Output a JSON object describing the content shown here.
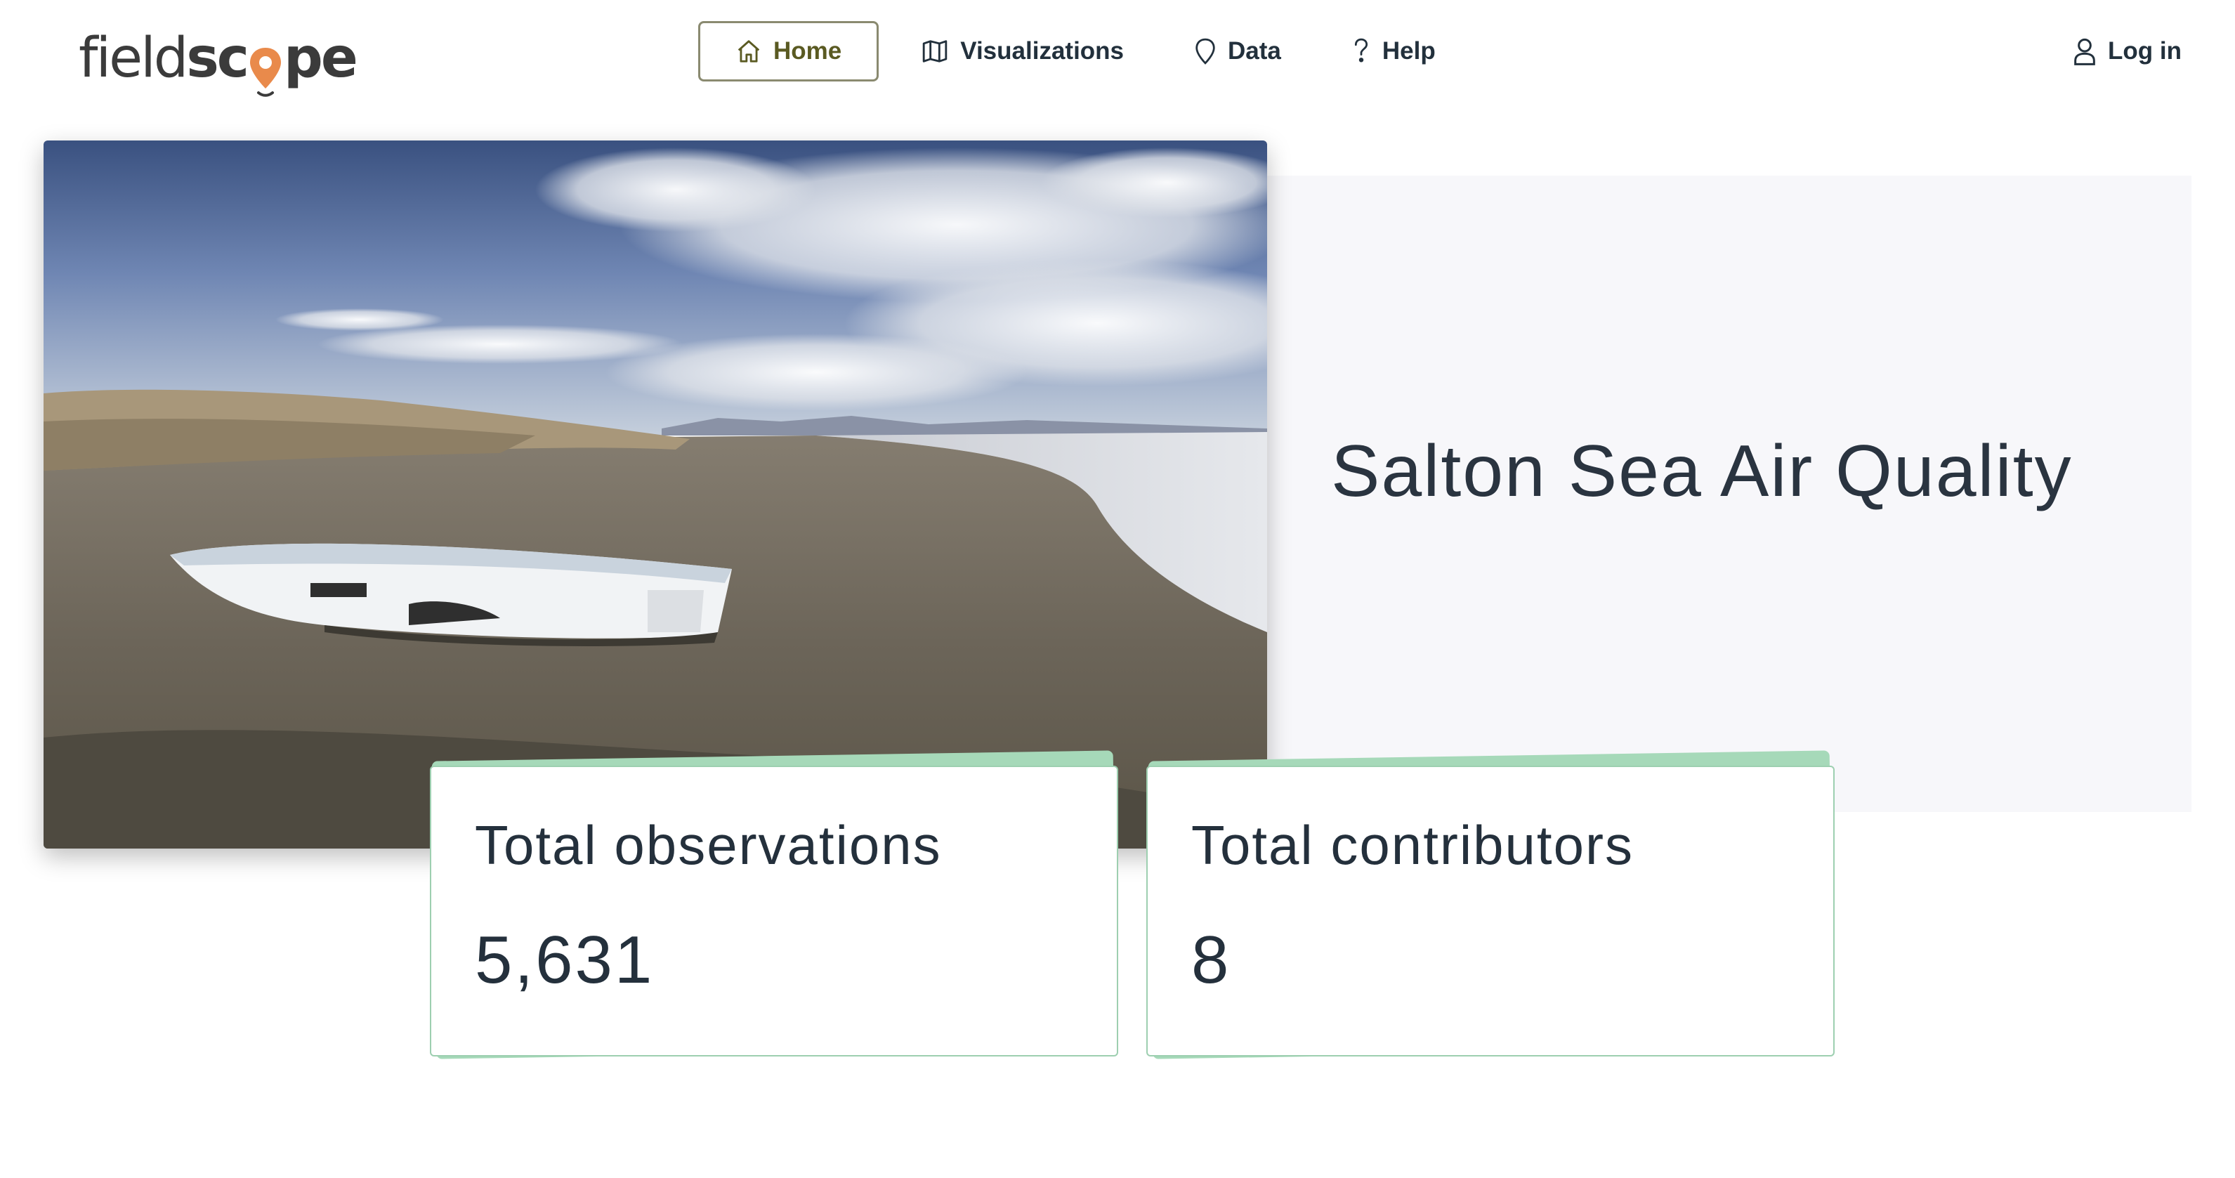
{
  "brand": {
    "logo_light": "field",
    "logo_bold_a": "sc",
    "logo_bold_b": "pe",
    "pin_color": "#e98a4b"
  },
  "nav": {
    "items": [
      {
        "label": "Home",
        "icon": "home-icon",
        "active": true
      },
      {
        "label": "Visualizations",
        "icon": "map-icon",
        "active": false
      },
      {
        "label": "Data",
        "icon": "map-pin-icon",
        "active": false
      },
      {
        "label": "Help",
        "icon": "help-icon",
        "active": false
      }
    ],
    "login_label": "Log in",
    "login_icon": "user-icon"
  },
  "hero": {
    "title": "Salton Sea Air Quality",
    "image_subject": "boat-on-shore-photo"
  },
  "stats": [
    {
      "label": "Total observations",
      "value": "5,631"
    },
    {
      "label": "Total contributors",
      "value": "8"
    }
  ],
  "colors": {
    "accent_green": "#a6d9b9",
    "active_nav_border": "#8a8a70",
    "active_nav_text": "#5a5a22",
    "hero_panel_bg": "#f7f7fa"
  }
}
